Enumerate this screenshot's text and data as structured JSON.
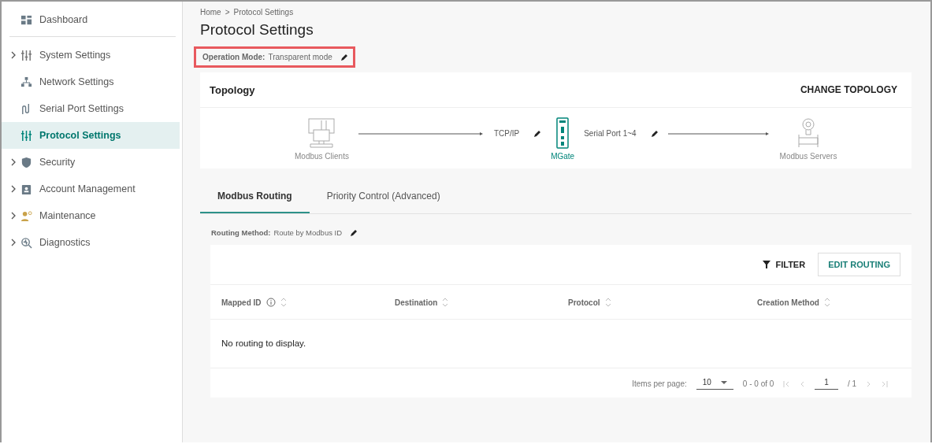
{
  "sidebar": {
    "groups": [
      {
        "items": [
          {
            "label": "Dashboard",
            "kind": "dashboard",
            "expandable": false,
            "selected": false
          }
        ]
      },
      {
        "items": [
          {
            "label": "System Settings",
            "kind": "sliders",
            "expandable": true,
            "selected": false
          },
          {
            "label": "Network Settings",
            "kind": "network",
            "expandable": false,
            "selected": false
          },
          {
            "label": "Serial Port Settings",
            "kind": "serial",
            "expandable": false,
            "selected": false
          },
          {
            "label": "Protocol Settings",
            "kind": "protocol",
            "expandable": false,
            "selected": true
          },
          {
            "label": "Security",
            "kind": "shield",
            "expandable": true,
            "selected": false
          },
          {
            "label": "Account Management",
            "kind": "account",
            "expandable": true,
            "selected": false
          },
          {
            "label": "Maintenance",
            "kind": "maintenance",
            "expandable": true,
            "selected": false
          },
          {
            "label": "Diagnostics",
            "kind": "diagnostics",
            "expandable": true,
            "selected": false
          }
        ]
      }
    ]
  },
  "breadcrumb": {
    "items": [
      "Home",
      "Protocol Settings"
    ],
    "separator": ">"
  },
  "page_title": "Protocol Settings",
  "operation_mode": {
    "label": "Operation Mode:",
    "value": "Transparent mode",
    "highlighted": true
  },
  "topology": {
    "title": "Topology",
    "action": "CHANGE TOPOLOGY",
    "nodes": [
      {
        "label": "Modbus Clients",
        "kind": "client"
      },
      {
        "label": "MGate",
        "kind": "gateway"
      },
      {
        "label": "Modbus Servers",
        "kind": "server"
      }
    ],
    "links": [
      {
        "label": "TCP/IP"
      },
      {
        "label": "Serial Port 1~4"
      }
    ]
  },
  "tabs": [
    {
      "label": "Modbus Routing",
      "selected": true
    },
    {
      "label": "Priority Control (Advanced)",
      "selected": false
    }
  ],
  "routing_method": {
    "label": "Routing Method:",
    "value": "Route by Modbus ID"
  },
  "table": {
    "filter": "FILTER",
    "edit": "EDIT ROUTING",
    "columns": [
      {
        "label": "Mapped ID",
        "info": true
      },
      {
        "label": "Destination",
        "info": false
      },
      {
        "label": "Protocol",
        "info": false
      },
      {
        "label": "Creation Method",
        "info": false
      }
    ],
    "empty": "No routing to display."
  },
  "paginator": {
    "label": "Items per page:",
    "page_size": "10",
    "range": "0 - 0 of 0",
    "page": "1",
    "total": "/ 1"
  }
}
